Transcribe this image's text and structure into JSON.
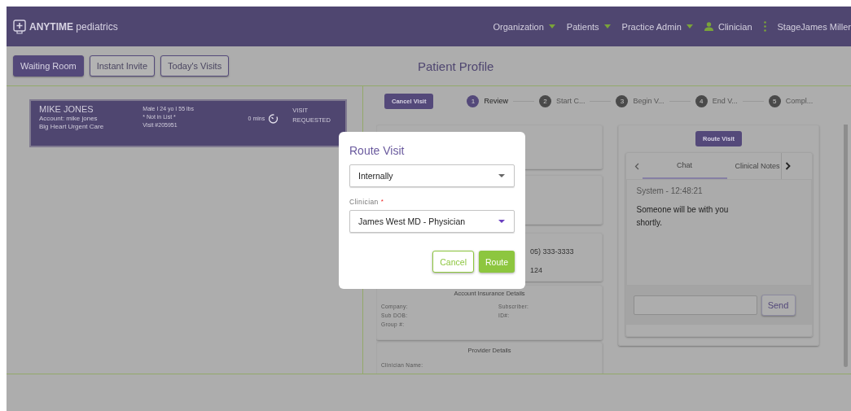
{
  "header": {
    "logo": "**ANYTIME** pediatrics",
    "nav": [
      {
        "label": "Organization",
        "kind": "dropdown"
      },
      {
        "label": "Patients",
        "kind": "dropdown"
      },
      {
        "label": "Practice Admin",
        "kind": "dropdown"
      },
      {
        "label": "Clinician",
        "kind": "user"
      },
      {
        "kind": "kebab"
      },
      {
        "label": "StageJames Miller",
        "kind": "plain"
      }
    ]
  },
  "toolbar": {
    "buttons": [
      {
        "label": "Waiting Room",
        "selected": true
      },
      {
        "label": "Instant Invite",
        "selected": false
      },
      {
        "label": "Today's Visits",
        "selected": false
      }
    ],
    "title": "Patient Profile"
  },
  "visit_card": {
    "name": "MIKE JONES",
    "account": "Account: mike jones",
    "location": "Big Heart Urgent Care",
    "details": [
      "Male I 24 yo I 55 lbs",
      "* Not in List *",
      "Visit #205951"
    ],
    "wait": "0 mins",
    "status": "VISIT REQUESTED"
  },
  "visit": {
    "cancel_button": "Cancel Visit",
    "steps": [
      {
        "number": "1",
        "label": "Review",
        "selected": true
      },
      {
        "number": "2",
        "label": "Start C...",
        "selected": false
      },
      {
        "number": "3",
        "label": "Begin V...",
        "selected": false
      },
      {
        "number": "4",
        "label": "End V...",
        "selected": false
      },
      {
        "number": "5",
        "label": "Compl...",
        "selected": false
      }
    ]
  },
  "contact_card": {
    "lines": [
      "05) 333-3333",
      "124"
    ]
  },
  "insurance_card": {
    "title": "Account Insurance Details",
    "fields": [
      "Company:",
      "Subscriber:",
      "Sub DOB:",
      "ID#:",
      "Group #:"
    ]
  },
  "provider_card": {
    "title": "Provider Details",
    "fields": [
      "Clinician Name:"
    ]
  },
  "chat_panel": {
    "route_button": "Route Visit",
    "tabs": [
      {
        "label": "Chat",
        "selected": true
      },
      {
        "label": "Clinical Notes",
        "selected": false
      }
    ],
    "message": {
      "sender": "System - 12:48:21",
      "text": "Someone will be with you shortly."
    },
    "send_button": "Send"
  },
  "modal": {
    "title": "Route Visit",
    "route_select": "Internally",
    "clinician_label": "Clinician",
    "required_mark": "*",
    "clinician_select": "James West MD - Physician",
    "buttons": [
      {
        "label": "Cancel",
        "kind": "secondary"
      },
      {
        "label": "Route",
        "kind": "primary"
      }
    ]
  }
}
